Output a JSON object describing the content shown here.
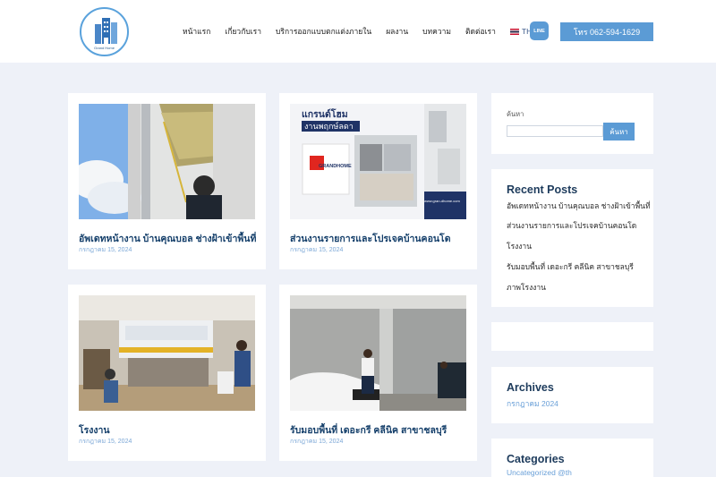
{
  "header": {
    "logo_text": "Grand Home",
    "nav": [
      "หน้าแรก",
      "เกี่ยวกับเรา",
      "บริการออกแบบตกแต่งภายใน",
      "ผลงาน",
      "บทความ",
      "ติดต่อเรา"
    ],
    "lang": "TH",
    "line_label": "LINE",
    "phone_label": "โทร 062-594-1629",
    "accent_color": "#5b9bd5"
  },
  "posts": [
    {
      "title": "อัพเดทหน้างาน บ้านคุณบอล ช่างฝ้าเข้าพื้นที่",
      "date": "กรกฎาคม 15, 2024"
    },
    {
      "title": "ส่วนงานรายการและโปรเจคบ้านคอนโด",
      "date": "กรกฎาคม 15, 2024",
      "image_heading_1": "แกรนด์โฮม",
      "image_heading_2": "งานพฤกษ์ลดา",
      "image_logo": "GRANDHOME",
      "image_url": "www.gran-dhome.com"
    },
    {
      "title": "โรงงาน",
      "date": "กรกฎาคม 15, 2024"
    },
    {
      "title": "รับมอบพื้นที่ เดอะกรี คลีนิค สาขาชลบุรี",
      "date": "กรกฎาคม 15, 2024"
    }
  ],
  "sidebar": {
    "search_label": "ค้นหา",
    "search_button": "ค้นหา",
    "search_value": "",
    "recent_title": "Recent Posts",
    "recent": [
      "อัพเดทหน้างาน บ้านคุณบอล ช่างฝ้าเข้าพื้นที่",
      "ส่วนงานรายการและโปรเจคบ้านคอนโด",
      "โรงงาน",
      "รับมอบพื้นที่ เดอะกรี คลีนิค สาขาชลบุรี",
      "ภาพโรงงาน"
    ],
    "archives_title": "Archives",
    "archives": [
      "กรกฎาคม 2024"
    ],
    "categories_title": "Categories",
    "categories": [
      "Uncategorized @th"
    ]
  }
}
